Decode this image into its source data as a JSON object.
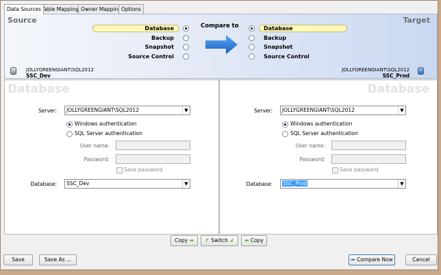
{
  "tabs": [
    "Data Sources",
    "Table Mapping",
    "Owner Mapping",
    "Options"
  ],
  "header": {
    "source_title": "Source",
    "target_title": "Target",
    "compare_to": "Compare to",
    "source_options": [
      "Database",
      "Backup",
      "Snapshot",
      "Source Control"
    ],
    "target_options": [
      "Database",
      "Backup",
      "Snapshot",
      "Source Control"
    ],
    "source_selected": "Database",
    "target_selected": "Database",
    "source_server": "JOLLYGREENGIANT\\SQL2012",
    "source_db": "SSC_Dev",
    "target_server": "JOLLYGREENGIANT\\SQL2012",
    "target_db": "SSC_Prod"
  },
  "source": {
    "watermark": "Database",
    "server_label": "Server:",
    "server": "JOLLYGREENGIANT\\SQL2012",
    "win_auth": "Windows authentication",
    "sql_auth": "SQL Server authentication",
    "user_label": "User name:",
    "password_label": "Password:",
    "save_password": "Save password",
    "database_label": "Database:",
    "database": "SSC_Dev"
  },
  "target": {
    "watermark": "Database",
    "server_label": "Server:",
    "server": "JOLLYGREENGIANT\\SQL2012",
    "win_auth": "Windows authentication",
    "sql_auth": "SQL Server authentication",
    "user_label": "User name:",
    "password_label": "Password:",
    "save_password": "Save password",
    "database_label": "Database:",
    "database": "SSC_Prod"
  },
  "middle_buttons": {
    "copy_right": "Copy",
    "switch": "Switch",
    "copy_left": "Copy"
  },
  "footer": {
    "save": "Save",
    "save_as": "Save As ...",
    "compare_now": "Compare Now",
    "cancel": "Cancel"
  }
}
